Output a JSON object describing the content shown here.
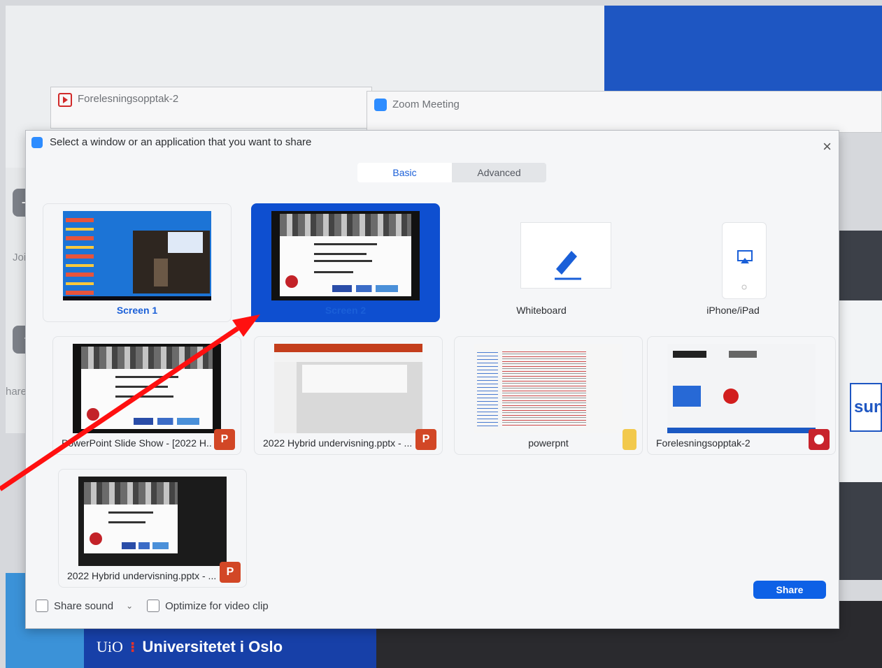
{
  "background": {
    "win1_title": "Forelesningsopptak-2",
    "win2_title": "Zoom Meeting",
    "left_join_text": "Join",
    "left_share_text": "hare sc",
    "banner_logo": "UiO",
    "banner_text": "Universitetet i Oslo",
    "right_sign_text": "sun"
  },
  "dialog": {
    "title": "Select a window or an application that you want to share",
    "tabs": [
      {
        "label": "Basic",
        "active": true
      },
      {
        "label": "Advanced",
        "active": false
      }
    ],
    "tiles": [
      {
        "label": "Screen 1",
        "type": "screen",
        "number": "1"
      },
      {
        "label": "Screen 2",
        "type": "screen",
        "number": "2",
        "selected": true
      },
      {
        "label": "Whiteboard",
        "type": "whiteboard"
      },
      {
        "label": "iPhone/iPad",
        "type": "ios"
      },
      {
        "label": "PowerPoint Slide Show - [2022 H...",
        "type": "app",
        "icon": "powerpoint-icon"
      },
      {
        "label": "2022 Hybrid undervisning.pptx - ...",
        "type": "app",
        "icon": "powerpoint-icon"
      },
      {
        "label": "powerpnt",
        "type": "app",
        "icon": "folder-icon"
      },
      {
        "label": "Forelesningsopptak-2",
        "type": "app",
        "icon": "record-icon"
      },
      {
        "label": "2022 Hybrid undervisning.pptx - ...",
        "type": "app",
        "icon": "powerpoint-icon"
      }
    ],
    "share_sound": "Share sound",
    "optimize_video": "Optimize for video clip",
    "share_button": "Share",
    "close_symbol": "×",
    "ppt_badge": "P"
  },
  "colors": {
    "accent": "#0e4fd0",
    "share_button": "#0e61e6",
    "annotation_arrow": "#ff1010"
  }
}
